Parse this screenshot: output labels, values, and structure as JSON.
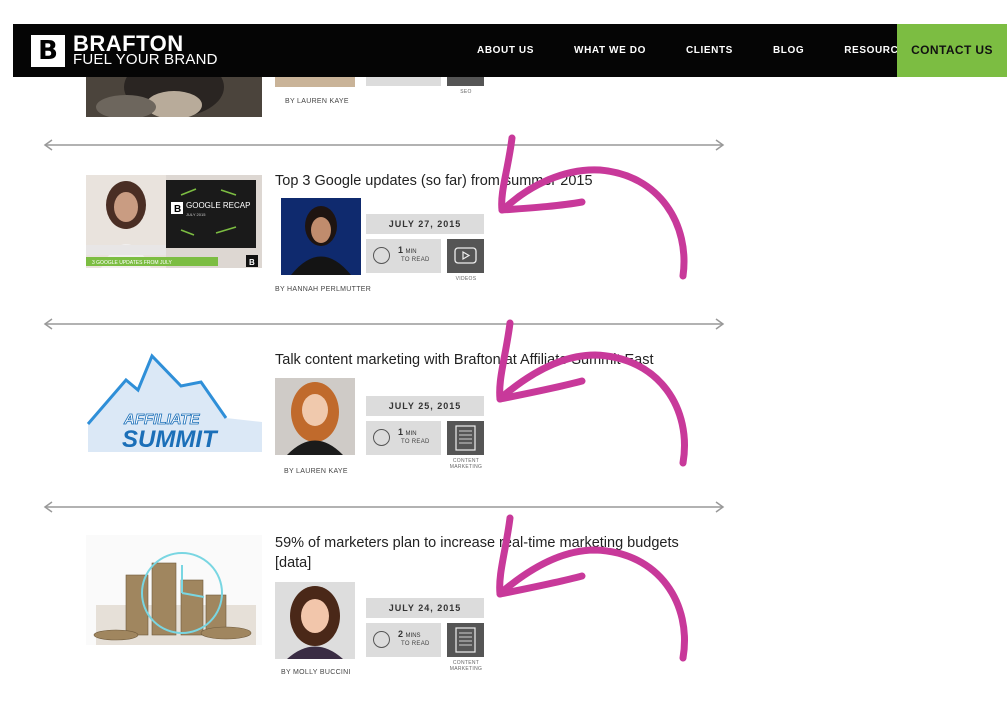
{
  "nav": {
    "logo_letter": "B",
    "brand": "BRAFTON",
    "tagline": "FUEL YOUR BRAND",
    "items": [
      "ABOUT US",
      "WHAT WE DO",
      "CLIENTS",
      "BLOG",
      "RESOURCES"
    ],
    "contact": "CONTACT US"
  },
  "top_post": {
    "author": "BY LAUREN KAYE",
    "category": "SEO"
  },
  "posts": [
    {
      "title": "Top 3 Google updates (so far) from summer 2015",
      "date": "JULY 27, 2015",
      "read_num": "1",
      "read_unit": "MIN",
      "read_label": "TO READ",
      "category": "VIDEOS",
      "author": "BY HANNAH PERLMUTTER",
      "thumb_title": "GOOGLE RECAP",
      "thumb_date": "JULY 2015",
      "thumb_caption": "3 GOOGLE UPDATES FROM JULY"
    },
    {
      "title": "Talk content marketing with Brafton at Affiliate Summit East",
      "date": "JULY 25, 2015",
      "read_num": "1",
      "read_unit": "MIN",
      "read_label": "TO READ",
      "category": "CONTENT MARKETING",
      "author": "BY LAUREN KAYE",
      "thumb_word1": "AFFILIATE",
      "thumb_word2": "SUMMIT"
    },
    {
      "title": "59% of marketers plan to increase real-time marketing budgets [data]",
      "date": "JULY 24, 2015",
      "read_num": "2",
      "read_unit": "MINS",
      "read_label": "TO READ",
      "category": "CONTENT MARKETING",
      "author": "BY MOLLY BUCCINI"
    }
  ],
  "colors": {
    "nav_bg": "#050505",
    "contact_bg": "#7cbd42",
    "annotation": "#c8399a",
    "meta_box": "#dcdcdc",
    "category_box": "#555555"
  },
  "icons": [
    "clock-icon",
    "play-icon",
    "document-icon",
    "double-arrow-icon",
    "curved-arrow-annotation"
  ]
}
